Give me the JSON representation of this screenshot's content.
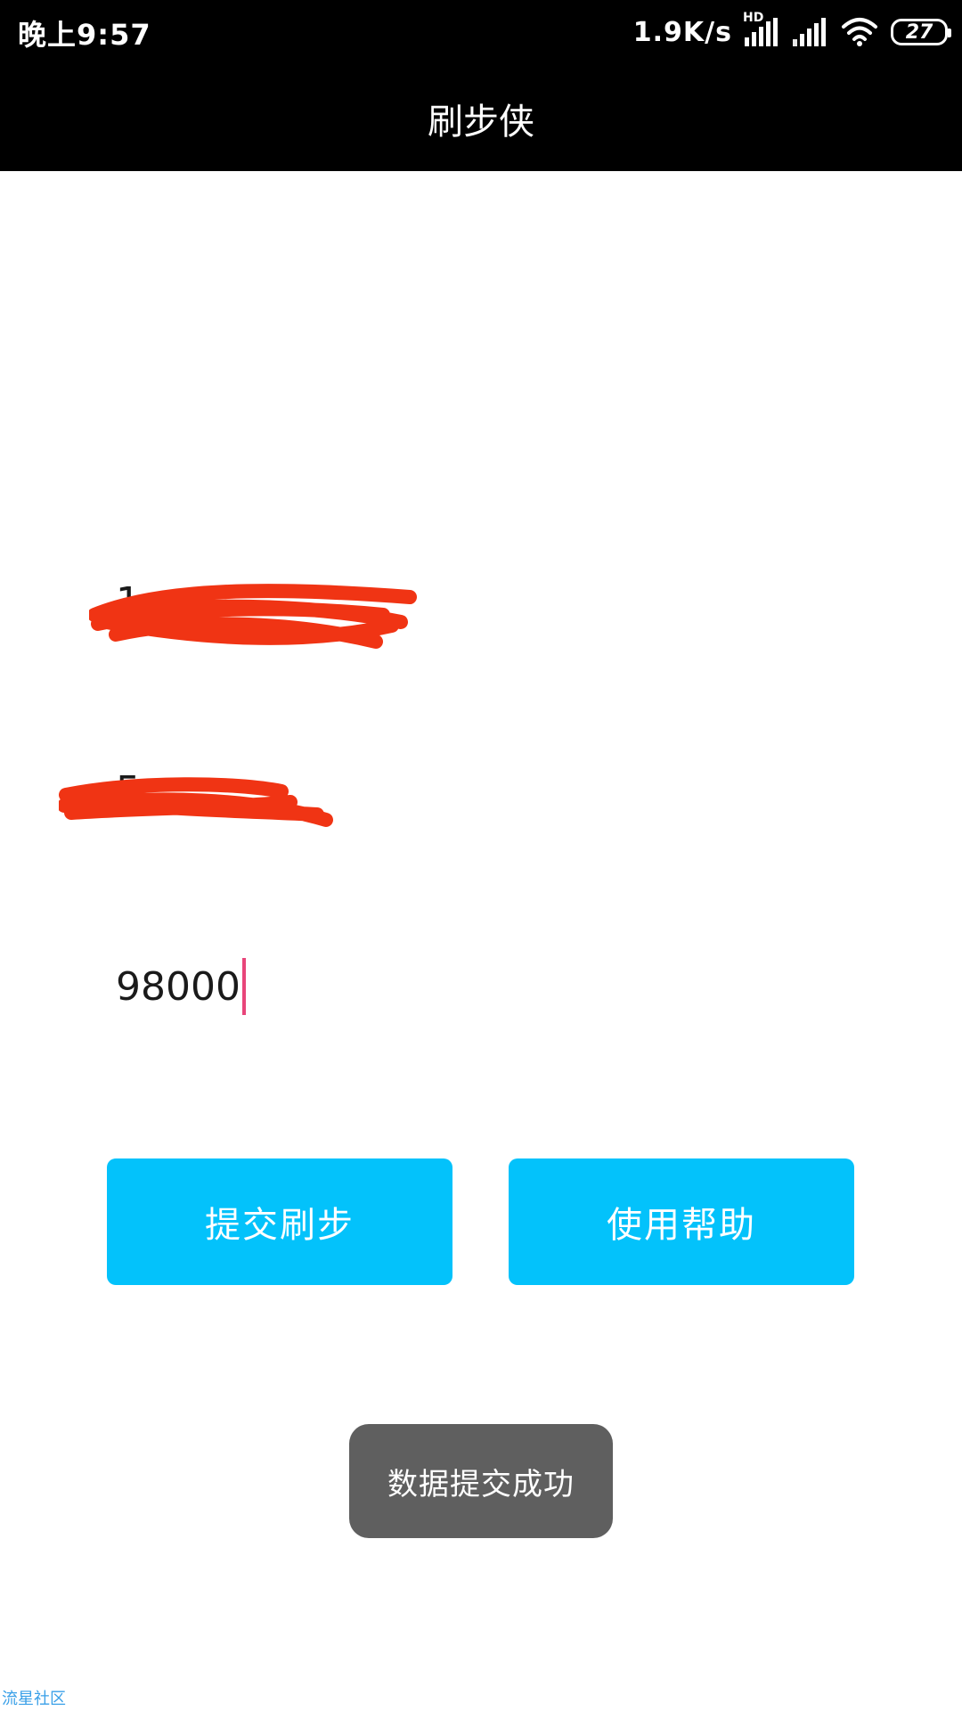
{
  "status_bar": {
    "time": "晚上9:57",
    "net_speed": "1.9K/s",
    "hd_label": "HD",
    "battery": "27",
    "icons": [
      "signal-icon",
      "signal-icon",
      "wifi-icon",
      "battery-icon"
    ]
  },
  "app_bar": {
    "title": "刷步侠"
  },
  "form": {
    "phone_value": "1",
    "password_value": "5",
    "steps_value": "98000",
    "cursor_color": "#e8457a",
    "redaction_color": "#f03414"
  },
  "buttons": {
    "submit_label": "提交刷步",
    "help_label": "使用帮助",
    "button_color": "#03c2fb"
  },
  "toast": {
    "message": "数据提交成功"
  },
  "watermark": {
    "text": "流星社区"
  }
}
